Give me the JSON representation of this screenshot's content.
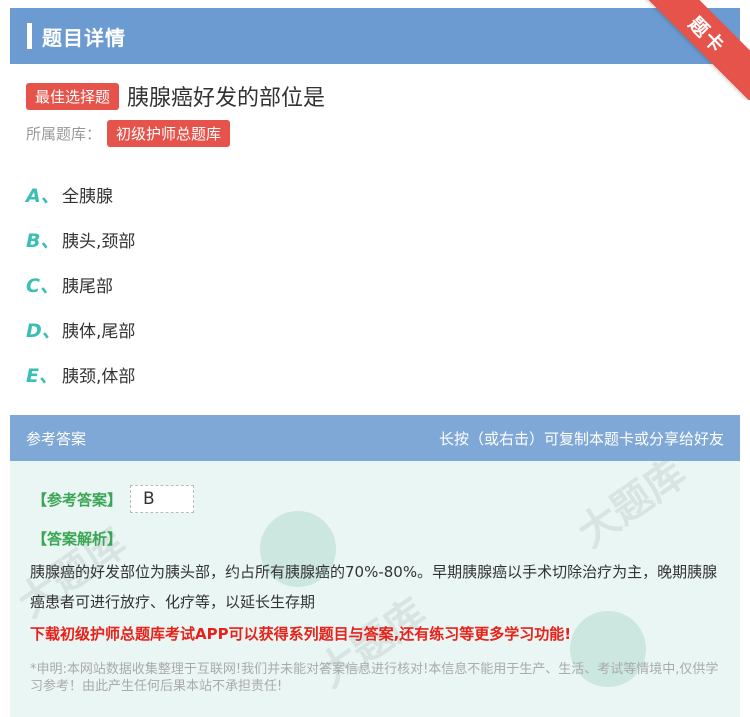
{
  "header": {
    "title": "题目详情"
  },
  "ribbon": {
    "label": "题卡"
  },
  "question": {
    "type_badge": "最佳选择题",
    "text": "胰腺癌好发的部位是",
    "bank_label": "所属题库：",
    "bank_name": "初级护师总题库"
  },
  "options": [
    {
      "letter": "A、",
      "text": "全胰腺"
    },
    {
      "letter": "B、",
      "text": "胰头,颈部"
    },
    {
      "letter": "C、",
      "text": "胰尾部"
    },
    {
      "letter": "D、",
      "text": "胰体,尾部"
    },
    {
      "letter": "E、",
      "text": "胰颈,体部"
    }
  ],
  "answer_section": {
    "title": "参考答案",
    "hint": "长按（或右击）可复制本题卡或分享给好友",
    "answer_label": "【参考答案】",
    "answer_value": "B",
    "analysis_label": "【答案解析】",
    "analysis_text": "胰腺癌的好发部位为胰头部，约占所有胰腺癌的70%-80%。早期胰腺癌以手术切除治疗为主，晚期胰腺癌患者可进行放疗、化疗等，以延长生存期",
    "promo": "下载初级护师总题库考试APP可以获得系列题目与答案,还有练习等更多学习功能!",
    "disclaimer": "*申明:本网站数据收集整理于互联网!我们并未能对答案信息进行核对!本信息不能用于生产、生活、考试等情境中,仅供学习参考！由此产生任何后果本站不承担责任!"
  },
  "colors": {
    "header": "#6b9bd1",
    "badge": "#e5534b",
    "option_letter": "#3bbfb4",
    "answer_label": "#3aa655",
    "promo": "#e8211a"
  }
}
